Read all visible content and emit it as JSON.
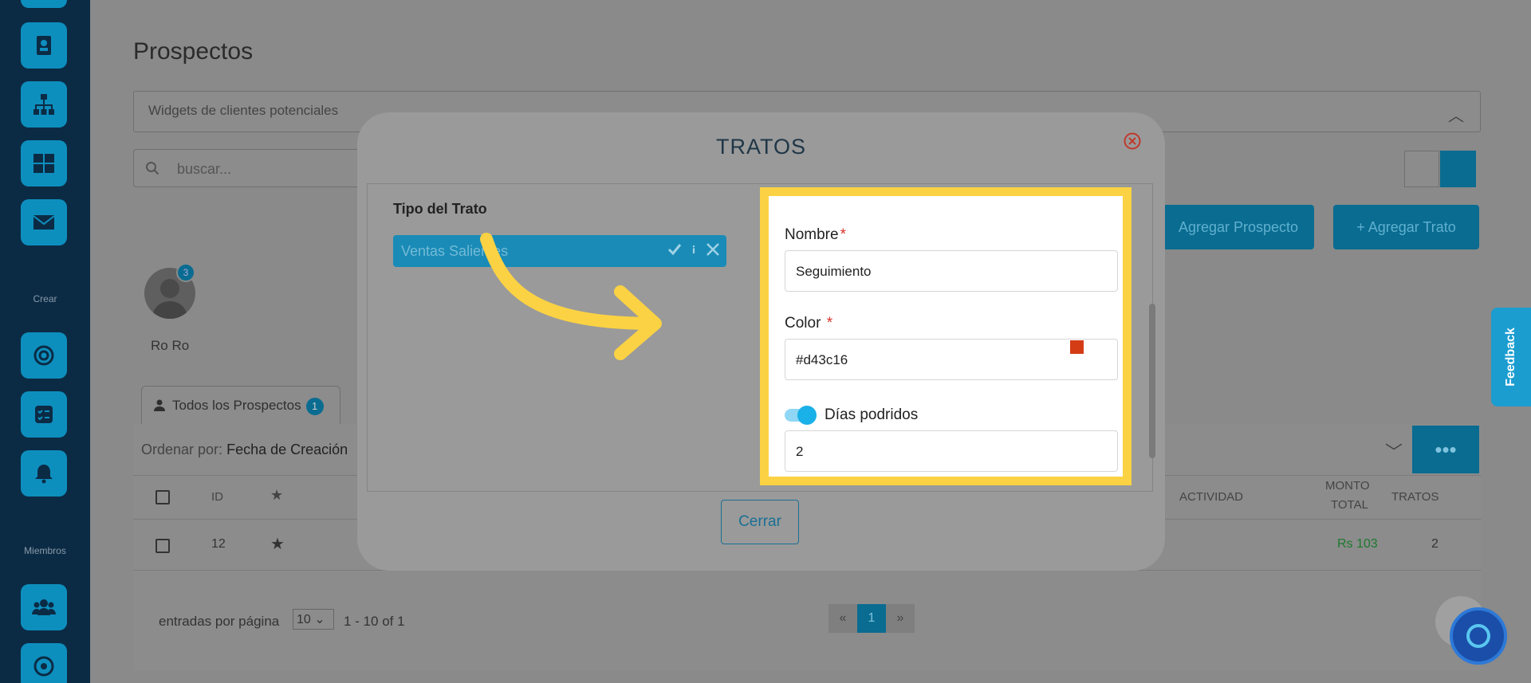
{
  "sidebar": {
    "section_crear": "Crear",
    "section_miembros": "Miembros"
  },
  "page": {
    "title": "Prospectos",
    "widgets_label": "Widgets de clientes potenciales",
    "search_placeholder": "buscar...",
    "btn_add_prospecto": "Agregar Prospecto",
    "btn_add_trato": "+ Agregar Trato",
    "avatar_badge": "3",
    "avatar_name": "Ro Ro",
    "tab_all": "Todos los Prospectos",
    "tab_all_count": "1",
    "sort_prefix": "Ordenar por:",
    "sort_value": "Fecha de Creación",
    "columns": {
      "id": "ID",
      "actividad": "ACTIVIDAD",
      "monto_line1": "MONTO",
      "monto_line2": "TOTAL",
      "tratos": "TRATOS"
    },
    "row": {
      "id": "12",
      "monto": "Rs 103",
      "tratos": "2"
    },
    "per_page_label": "entradas por página",
    "per_page_value": "10",
    "range": "1 - 10 of 1",
    "pager": {
      "prev": "«",
      "current": "1",
      "next": "»"
    },
    "feedback": "Feedback",
    "more_icon": "ellipsis-icon"
  },
  "modal": {
    "title": "TRATOS",
    "tipo_label": "Tipo del Trato",
    "tipo_chip": "Ventas Salientes",
    "close_label": "Cerrar"
  },
  "form": {
    "nombre_label": "Nombre",
    "nombre_value": "Seguimiento",
    "color_label": "Color",
    "color_value": "#d43c16",
    "dias_label": "Días podridos",
    "dias_enabled": true,
    "dias_value": "2",
    "required_mark": "*"
  },
  "colors": {
    "highlight": "#fbd243",
    "swatch": "#d43c16",
    "accent": "#1a8bb7",
    "toggle": "#1ab0e8"
  }
}
